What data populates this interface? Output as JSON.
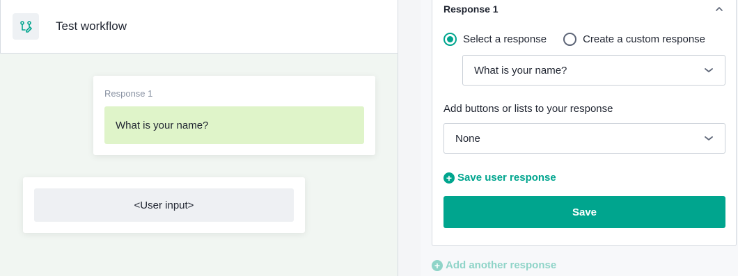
{
  "workflow": {
    "title": "Test workflow",
    "icon": "workflow-icon"
  },
  "canvas": {
    "response_card": {
      "label": "Response 1",
      "message": "What is your name?"
    },
    "input_card": {
      "text": "<User input>"
    }
  },
  "config": {
    "section_title": "Response 1",
    "collapse_icon": "chevron-up-icon",
    "radio_options": [
      {
        "label": "Select a response",
        "selected": true
      },
      {
        "label": "Create a custom response",
        "selected": false
      }
    ],
    "response_select_value": "What is your name?",
    "buttons_label": "Add buttons or lists to your response",
    "buttons_select_value": "None",
    "save_user_response": "Save user response",
    "save_button": "Save",
    "add_another": "Add another response"
  },
  "colors": {
    "accent": "#00a58e",
    "accent_light": "#8fd4c8",
    "bubble": "#dff4c9",
    "canvas_bg": "#f1f6f2"
  }
}
